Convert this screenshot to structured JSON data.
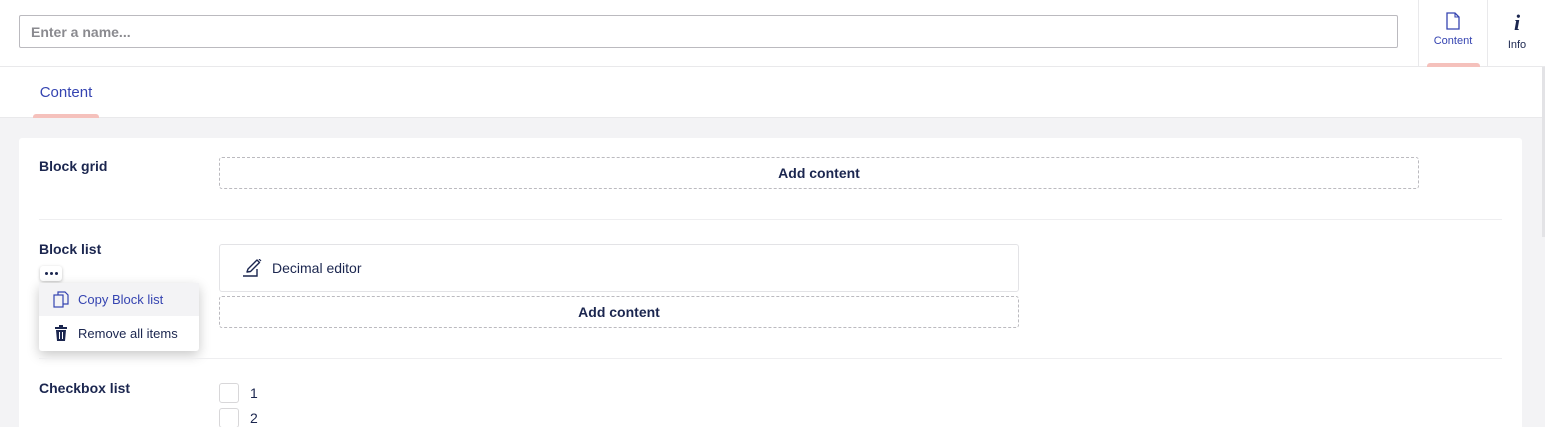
{
  "header": {
    "name_placeholder": "Enter a name...",
    "apps": [
      {
        "label": "Content",
        "icon": "document-icon"
      },
      {
        "label": "Info",
        "icon": "info-icon"
      }
    ]
  },
  "tabs": [
    {
      "label": "Content"
    }
  ],
  "properties": {
    "block_grid": {
      "label": "Block grid",
      "add_label": "Add content"
    },
    "block_list": {
      "label": "Block list",
      "items": [
        {
          "label": "Decimal editor",
          "icon": "edit-icon"
        }
      ],
      "add_label": "Add content",
      "menu": [
        {
          "label": "Copy Block list",
          "icon": "copy-icon"
        },
        {
          "label": "Remove all items",
          "icon": "trash-icon"
        }
      ]
    },
    "checkbox_list": {
      "label": "Checkbox list",
      "options": [
        {
          "label": "1"
        },
        {
          "label": "2"
        }
      ]
    }
  },
  "colors": {
    "accent": "#3544b1",
    "indicator": "#f5c1bc",
    "text": "#1b264f"
  }
}
